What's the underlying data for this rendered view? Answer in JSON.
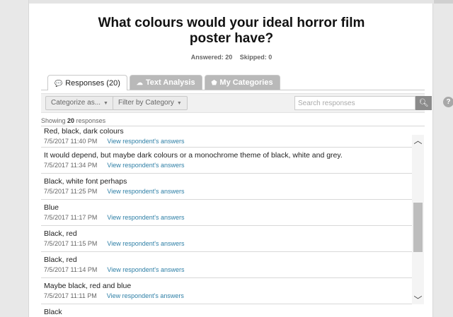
{
  "survey": {
    "question_line1": "What colours would your ideal horror film",
    "question_line2": "poster have?",
    "answered_label": "Answered: 20",
    "skipped_label": "Skipped: 0"
  },
  "tabs": [
    {
      "label": "Responses (20)",
      "icon": "speech-bubble-icon",
      "active": true
    },
    {
      "label": "Text Analysis",
      "icon": "cloud-icon",
      "active": false
    },
    {
      "label": "My Categories",
      "icon": "tag-icon",
      "active": false
    }
  ],
  "toolbar": {
    "categorize_label": "Categorize as...",
    "filter_label": "Filter by Category",
    "search_placeholder": "Search responses",
    "help_label": "?"
  },
  "showing": {
    "prefix": "Showing",
    "count": "20",
    "suffix": "responses"
  },
  "responses": [
    {
      "text": "Red, black, dark colours",
      "date": "7/5/2017 11:40 PM",
      "link": "View respondent's answers"
    },
    {
      "text": "It would depend, but maybe dark colours or a monochrome theme of black, white and grey.",
      "date": "7/5/2017 11:34 PM",
      "link": "View respondent's answers"
    },
    {
      "text": "Black, white font perhaps",
      "date": "7/5/2017 11:25 PM",
      "link": "View respondent's answers"
    },
    {
      "text": "Blue",
      "date": "7/5/2017 11:17 PM",
      "link": "View respondent's answers"
    },
    {
      "text": "Black, red",
      "date": "7/5/2017 11:15 PM",
      "link": "View respondent's answers"
    },
    {
      "text": "Black, red",
      "date": "7/5/2017 11:14 PM",
      "link": "View respondent's answers"
    },
    {
      "text": "Maybe black, red and blue",
      "date": "7/5/2017 11:11 PM",
      "link": "View respondent's answers"
    },
    {
      "text": "Black",
      "date": "",
      "link": ""
    }
  ],
  "colors": {
    "link": "#2e7fa6",
    "inactive_tab": "#b9b9b9"
  }
}
